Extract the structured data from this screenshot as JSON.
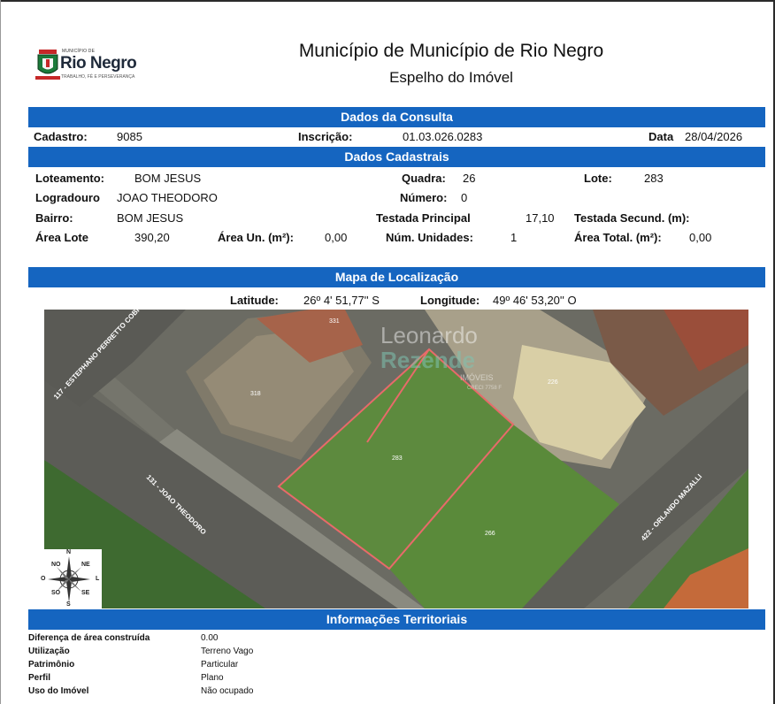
{
  "header": {
    "logo_small": "MUNICÍPIO DE",
    "logo_name": "Rio Negro",
    "logo_motto": "TRABALHO, FÉ E PERSEVERANÇA",
    "title": "Município de Município de Rio Negro",
    "subtitle": "Espelho do Imóvel"
  },
  "consulta": {
    "heading": "Dados da Consulta",
    "cadastro_label": "Cadastro:",
    "cadastro_value": "9085",
    "inscricao_label": "Inscrição:",
    "inscricao_value": "01.03.026.0283",
    "data_label": "Data",
    "data_value": "28/04/2026"
  },
  "cadastrais": {
    "heading": "Dados Cadastrais",
    "loteamento_label": "Loteamento:",
    "loteamento_value": "BOM JESUS",
    "quadra_label": "Quadra:",
    "quadra_value": "26",
    "lote_label": "Lote:",
    "lote_value": "283",
    "logradouro_label": "Logradouro",
    "logradouro_value": "JOAO THEODORO",
    "numero_label": "Número:",
    "numero_value": "0",
    "bairro_label": "Bairro:",
    "bairro_value": "BOM JESUS",
    "testada_principal_label": "Testada Principal",
    "testada_principal_value": "17,10",
    "testada_secund_label": "Testada Secund. (m):",
    "area_lote_label": "Área Lote",
    "area_lote_value": "390,20",
    "area_un_label": "Área Un. (m²):",
    "area_un_value": "0,00",
    "num_unidades_label": "Núm. Unidades:",
    "num_unidades_value": "1",
    "area_total_label": "Área Total. (m²):",
    "area_total_value": "0,00"
  },
  "mapa": {
    "heading": "Mapa de Localização",
    "latitude_label": "Latitude:",
    "latitude_value": "26º 4' 51,77'' S",
    "longitude_label": "Longitude:",
    "longitude_value": "49º 46' 53,20'' O",
    "street_labels": [
      "117 - ESTEPHANO PERRETTO COBR",
      "131 - JOAO THEODORO",
      "422 - ORLANDO MAZALLI"
    ],
    "lot_numbers": [
      "331",
      "318",
      "226",
      "283",
      "266"
    ],
    "watermark": [
      "Leonardo",
      "Rezende",
      "IMÓVEIS",
      "CRECI 7758 F"
    ],
    "compass": {
      "n": "N",
      "s": "S",
      "o": "O",
      "l": "L",
      "no": "NO",
      "ne": "NE",
      "so": "SO",
      "se": "SE"
    },
    "colors": {
      "lot_outline": "#e86a6a",
      "grass": "#5d8a3e",
      "road": "#5a5a55"
    }
  },
  "territoriais": {
    "heading": "Informações Territoriais",
    "rows": [
      {
        "label": "Diferença de área construída",
        "value": "0.00"
      },
      {
        "label": "Utilização",
        "value": "Terreno Vago"
      },
      {
        "label": "Patrimônio",
        "value": "Particular"
      },
      {
        "label": "Perfil",
        "value": "Plano"
      },
      {
        "label": "Uso do Imóvel",
        "value": "Não ocupado"
      }
    ]
  },
  "colors": {
    "header_bar": "#1565c0",
    "header_text": "#ffffff"
  }
}
